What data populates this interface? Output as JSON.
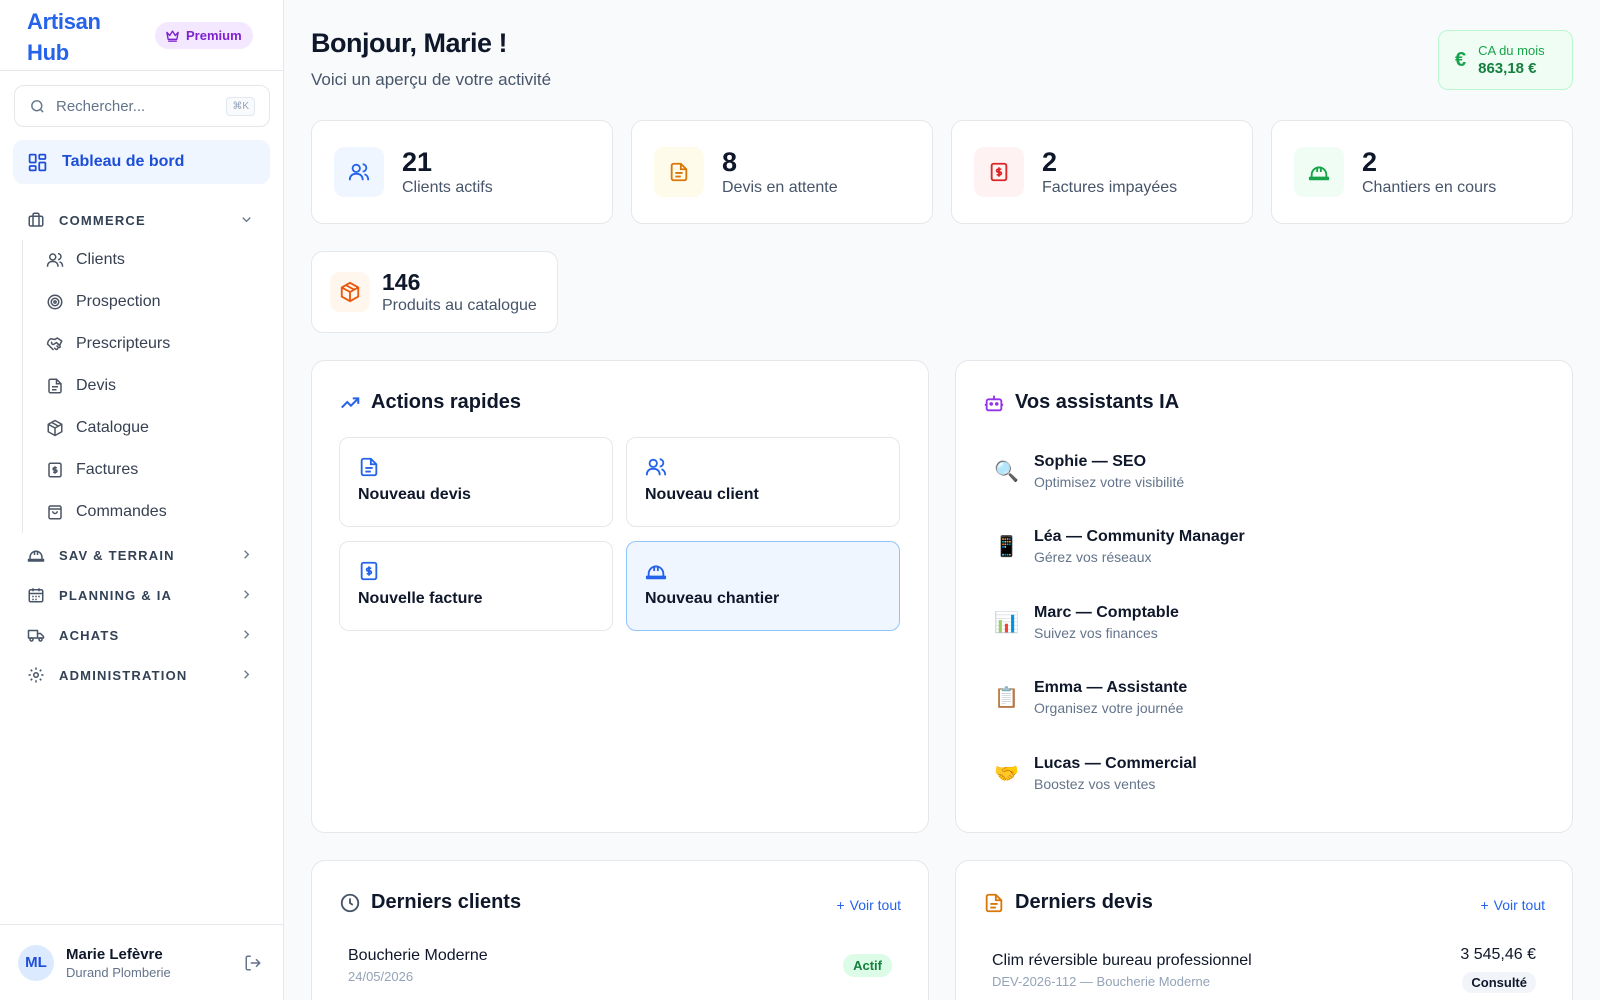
{
  "sidebar": {
    "brand": "Artisan Hub",
    "premium_label": "Premium",
    "search": {
      "placeholder": "Rechercher...",
      "shortcut": "⌘K"
    },
    "dashboard_label": "Tableau de bord",
    "sections": {
      "commerce": "COMMERCE",
      "sav": "SAV & TERRAIN",
      "planning": "PLANNING & IA",
      "achats": "ACHATS",
      "admin": "ADMINISTRATION"
    },
    "commerce_items": [
      "Clients",
      "Prospection",
      "Prescripteurs",
      "Devis",
      "Catalogue",
      "Factures",
      "Commandes"
    ],
    "user": {
      "initials": "ML",
      "name": "Marie Lefèvre",
      "company": "Durand Plomberie"
    }
  },
  "header": {
    "greeting": "Bonjour, Marie !",
    "subtitle": "Voici un aperçu de votre activité",
    "ca_label": "CA du mois",
    "ca_value": "863,18 €"
  },
  "stats": [
    {
      "value": "21",
      "label": "Clients actifs",
      "icon": "users-icon"
    },
    {
      "value": "8",
      "label": "Devis en attente",
      "icon": "document-icon"
    },
    {
      "value": "2",
      "label": "Factures impayées",
      "icon": "invoice-icon"
    },
    {
      "value": "2",
      "label": "Chantiers en cours",
      "icon": "hard-hat-icon"
    },
    {
      "value": "146",
      "label": "Produits au catalogue",
      "icon": "package-icon"
    }
  ],
  "quick_actions": {
    "title": "Actions rapides",
    "items": [
      "Nouveau devis",
      "Nouveau client",
      "Nouvelle facture",
      "Nouveau chantier"
    ]
  },
  "assistants": {
    "title": "Vos assistants IA",
    "items": [
      {
        "emoji": "🔍",
        "name": "Sophie — SEO",
        "desc": "Optimisez votre visibilité"
      },
      {
        "emoji": "📱",
        "name": "Léa — Community Manager",
        "desc": "Gérez vos réseaux"
      },
      {
        "emoji": "📊",
        "name": "Marc — Comptable",
        "desc": "Suivez vos finances"
      },
      {
        "emoji": "📋",
        "name": "Emma — Assistante",
        "desc": "Organisez votre journée"
      },
      {
        "emoji": "🤝",
        "name": "Lucas — Commercial",
        "desc": "Boostez vos ventes"
      }
    ]
  },
  "recent_clients": {
    "title": "Derniers clients",
    "see_all": "Voir tout",
    "rows": [
      {
        "name": "Boucherie Moderne",
        "date": "24/05/2026",
        "status": "Actif"
      }
    ]
  },
  "recent_quotes": {
    "title": "Derniers devis",
    "see_all": "Voir tout",
    "rows": [
      {
        "title": "Clim réversible bureau professionnel",
        "ref": "DEV-2026-112 — Boucherie Moderne",
        "amount": "3 545,46 €",
        "status": "Consulté"
      }
    ]
  },
  "colors": {
    "accent": "#2563eb",
    "success": "#16a34a",
    "premium": "#7e22ce",
    "danger": "#dc2626",
    "warning": "#d97706"
  }
}
